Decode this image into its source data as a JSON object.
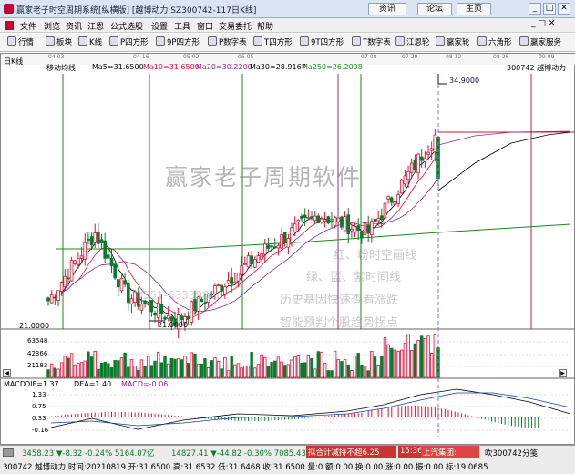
{
  "app": {
    "title": "赢家老子时空周期系统[纵横版]",
    "stock_title": "[越博动力  SZ300742-117日K线]",
    "links": [
      "资讯",
      "论坛",
      "主页"
    ]
  },
  "menu": [
    "文件",
    "浏览",
    "资讯",
    "江恩",
    "公式选股",
    "设置",
    "工具",
    "窗口",
    "交易委托",
    "帮助"
  ],
  "toolbar": [
    "行情",
    "板块",
    "K线",
    "P四方形",
    "9P四方形",
    "P数字表",
    "T四方形",
    "9T四方形",
    "T数字表",
    "江恩轮",
    "赢家轮",
    "六角形",
    "赢家服务"
  ],
  "chart": {
    "period_label": "日K线",
    "ma_label": "移动均线",
    "ma5": "Ma5=31.6500",
    "ma10": "Ma10=31.6500",
    "ma20": "Ma20=30.2200",
    "ma30": "Ma30=28.9167",
    "ma250": "Ma250=26.2008",
    "code_label": "300742  越博动力",
    "high_label": "34.9000",
    "low_label": "21.0000",
    "low_mark": "21.0000",
    "dates": [
      "04-03",
      "04-16",
      "05-02",
      "06-05",
      "07-08",
      "07-29",
      "08-12",
      "08-26",
      "09-09"
    ],
    "volume_ticks": [
      "63548",
      "42366",
      "21183"
    ],
    "macd_label": "MACD",
    "dif": "DIF=1.37",
    "dea": "DEA=1.40",
    "macd": "MACD=-0.06",
    "macd_ticks": [
      "1.33",
      "0.75",
      "0.33",
      "-0.16"
    ],
    "watermark": "赢家老子周期软件",
    "overlay_text": [
      "红、粉时空画线",
      "绿、蓝、紫时间线",
      "历史基因快速查看涨跌",
      "智能预判个股趋势拐点"
    ],
    "phone_text": "0551-63339800",
    "colors": {
      "up": "#d4143c",
      "down": "#0a7a2c",
      "ma5": "#000000",
      "ma10": "#d4143c",
      "ma20": "#8a2c8a",
      "ma250": "#1a8a1a"
    }
  },
  "status": {
    "sh": "3458.23",
    "sh_chg": "▼-8.32",
    "sh_pct": "-0.24%",
    "sh_amt": "5164.07亿",
    "sz": "14827.41",
    "sz_chg": "▼-44.82",
    "sz_pct": "-0.30%",
    "sz_amt": "7085.43亿",
    "news": "拟合计减持不超6.25",
    "time": "15:36",
    "news2": "上汽集团:",
    "user": "吹300742分笺",
    "quote": "300742 越博动力 时间:20210819 开:31.6500 高:31.6532 低:31.6468 收:31.6500 量:0 额:0.00 换:0.00 涨:0.00 振:0.00 标:19.0685"
  }
}
